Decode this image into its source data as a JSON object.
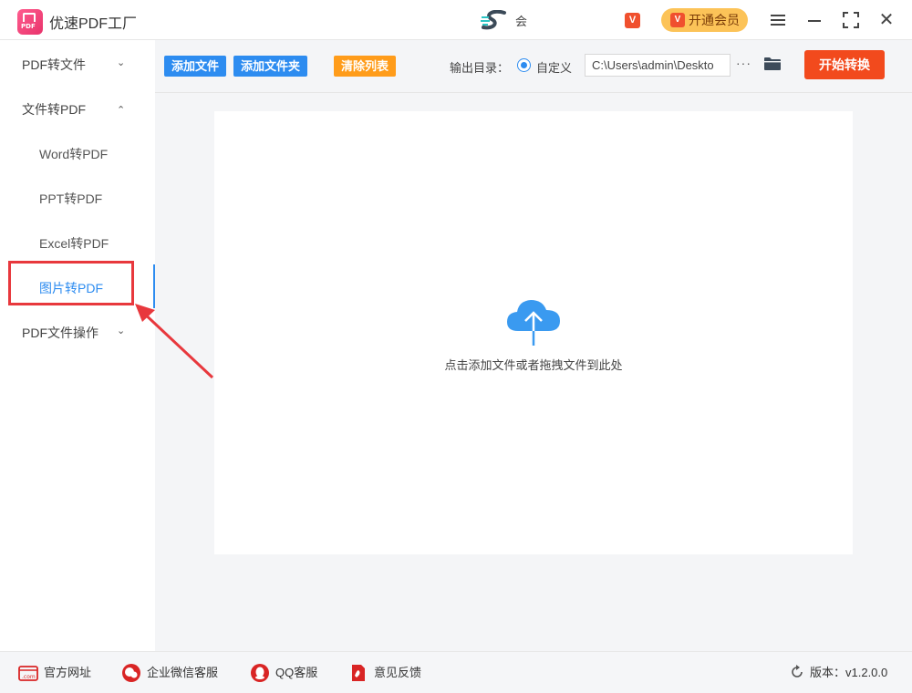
{
  "titlebar": {
    "app_title": "优速PDF工厂",
    "center_text": "会",
    "vip_small": "V",
    "vip_button": "开通会员",
    "vip_badge": "V"
  },
  "sidebar": {
    "groups": [
      {
        "label": "PDF转文件",
        "chevron": "⌄"
      },
      {
        "label": "文件转PDF",
        "chevron": "⌃"
      },
      {
        "label": "PDF文件操作",
        "chevron": "⌄"
      }
    ],
    "items": [
      {
        "label": "Word转PDF"
      },
      {
        "label": "PPT转PDF"
      },
      {
        "label": "Excel转PDF"
      },
      {
        "label": "图片转PDF"
      }
    ],
    "active_index": 3
  },
  "toolbar": {
    "add_file": "添加文件",
    "add_folder": "添加文件夹",
    "clear_list": "清除列表",
    "output_label": "输出目录：",
    "custom_label": "自定义",
    "path_value": "C:\\Users\\admin\\Deskto",
    "more": "···",
    "start": "开始转换"
  },
  "dropzone": {
    "text": "点击添加文件或者拖拽文件到此处"
  },
  "footer": {
    "links": [
      {
        "label": "官方网址",
        "icon": "web-icon"
      },
      {
        "label": "企业微信客服",
        "icon": "wechat-icon"
      },
      {
        "label": "QQ客服",
        "icon": "qq-icon"
      },
      {
        "label": "意见反馈",
        "icon": "feedback-icon"
      }
    ],
    "version": "版本：v1.2.0.0"
  },
  "colors": {
    "accent": "#2d8cf0",
    "start": "#f24a1d",
    "clear": "#ff9c1a",
    "highlight": "#e8383d"
  }
}
